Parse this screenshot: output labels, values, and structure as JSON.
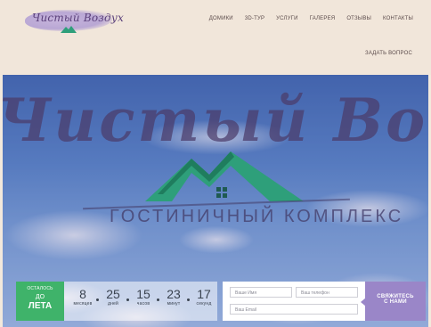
{
  "header": {
    "logo_text": "Чистый Воздух",
    "nav": [
      "ДОМИКИ",
      "3D-ТУР",
      "УСЛУГИ",
      "ГАЛЕРЕЯ",
      "ОТЗЫВЫ",
      "КОНТАКТЫ"
    ],
    "ask_question": "ЗАДАТЬ ВОПРОС"
  },
  "hero": {
    "brand_script": "Чистый Воздух",
    "subtitle": "ГОСТИНИЧНЫЙ КОМПЛЕКС"
  },
  "countdown": {
    "prefix": "ОСТАЛОСЬ",
    "until": "ДО",
    "target": "ЛЕТА",
    "units": [
      {
        "value": "8",
        "label": "месяцев"
      },
      {
        "value": "25",
        "label": "дней"
      },
      {
        "value": "15",
        "label": "часов"
      },
      {
        "value": "23",
        "label": "минут"
      },
      {
        "value": "17",
        "label": "секунд"
      }
    ]
  },
  "form": {
    "name_placeholder": "Ваше Имя",
    "phone_placeholder": "Ваш телефон",
    "email_placeholder": "Ваш Email",
    "submit_line1": "СВЯЖИТЕСЬ",
    "submit_line2": "С НАМИ"
  },
  "colors": {
    "header_bg": "#f1e6da",
    "accent_purple": "#9a86c8",
    "accent_green": "#3fb36a",
    "mountain_green": "#2e9f7a"
  }
}
